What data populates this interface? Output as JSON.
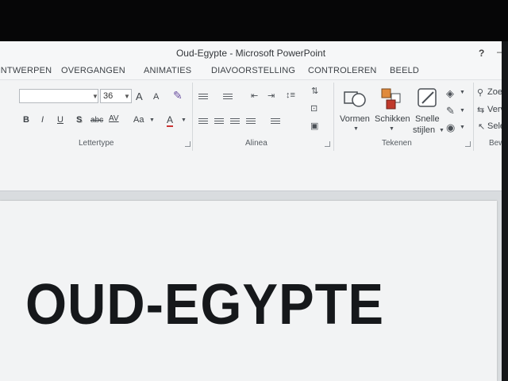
{
  "window": {
    "title": "Oud-Egypte - Microsoft PowerPoint",
    "help_label": "?",
    "minimize_label": "–"
  },
  "tabs": [
    "ONTWERPEN",
    "OVERGANGEN",
    "ANIMATIES",
    "DIAVOORSTELLING",
    "CONTROLEREN",
    "BEELD"
  ],
  "font_group": {
    "label": "Lettertype",
    "font_name": "",
    "font_size": "36",
    "grow_label": "A",
    "shrink_label": "A",
    "bold": "B",
    "italic": "I",
    "underline": "U",
    "shadow": "S",
    "strike": "abc",
    "spacing": "AV",
    "case": "Aa",
    "color": "A"
  },
  "paragraph_group": {
    "label": "Alinea"
  },
  "drawing_group": {
    "label": "Tekenen",
    "shapes": "Vormen",
    "arrange": "Schikken",
    "quick_styles_line1": "Snelle",
    "quick_styles_line2": "stijlen"
  },
  "editing_group": {
    "find": "Zoek",
    "replace": "Verv",
    "select": "Sele",
    "label": "Bew"
  },
  "slide": {
    "title": "OUD-EGYPTE"
  },
  "colors": {
    "ribbon": "#f3f4f5",
    "titlebar": "#f6f7f8",
    "slide_bg": "#f2f3f4",
    "title_text": "#16181b"
  }
}
